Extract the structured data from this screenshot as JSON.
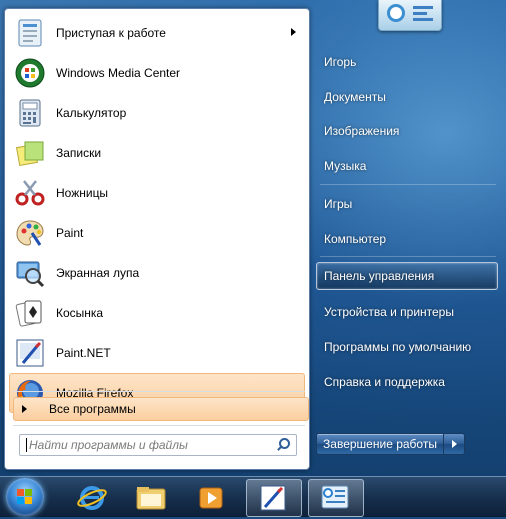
{
  "programs": [
    {
      "label": "Приступая к работе",
      "icon": "getting-started-icon",
      "submenu": true
    },
    {
      "label": "Windows Media Center",
      "icon": "media-center-icon"
    },
    {
      "label": "Калькулятор",
      "icon": "calculator-icon"
    },
    {
      "label": "Записки",
      "icon": "sticky-notes-icon"
    },
    {
      "label": "Ножницы",
      "icon": "scissors-icon"
    },
    {
      "label": "Paint",
      "icon": "paint-palette-icon"
    },
    {
      "label": "Экранная лупа",
      "icon": "magnifier-icon"
    },
    {
      "label": "Косынка",
      "icon": "solitaire-cards-icon"
    },
    {
      "label": "Paint.NET",
      "icon": "paint-net-icon"
    },
    {
      "label": "Mozilla Firefox",
      "icon": "firefox-icon",
      "highlighted": true
    }
  ],
  "all_programs_label": "Все программы",
  "search": {
    "placeholder": "Найти программы и файлы"
  },
  "right_links": [
    {
      "label": "Игорь"
    },
    {
      "label": "Документы"
    },
    {
      "label": "Изображения"
    },
    {
      "label": "Музыка"
    },
    {
      "label": "Игры"
    },
    {
      "label": "Компьютер"
    },
    {
      "label": "Панель управления",
      "highlighted": true
    },
    {
      "label": "Устройства и принтеры"
    },
    {
      "label": "Программы по умолчанию"
    },
    {
      "label": "Справка и поддержка"
    }
  ],
  "shutdown_label": "Завершение работы",
  "taskbar_items": [
    {
      "icon": "internet-explorer-icon"
    },
    {
      "icon": "windows-explorer-icon"
    },
    {
      "icon": "media-player-icon"
    },
    {
      "icon": "paint-net-taskbar-icon",
      "active": true
    },
    {
      "icon": "control-panel-taskbar-icon",
      "active": true
    }
  ],
  "colors": {
    "highlight": "#fccf9f",
    "panel_border": "#5d7ea8",
    "taskbar": "#17304e"
  }
}
